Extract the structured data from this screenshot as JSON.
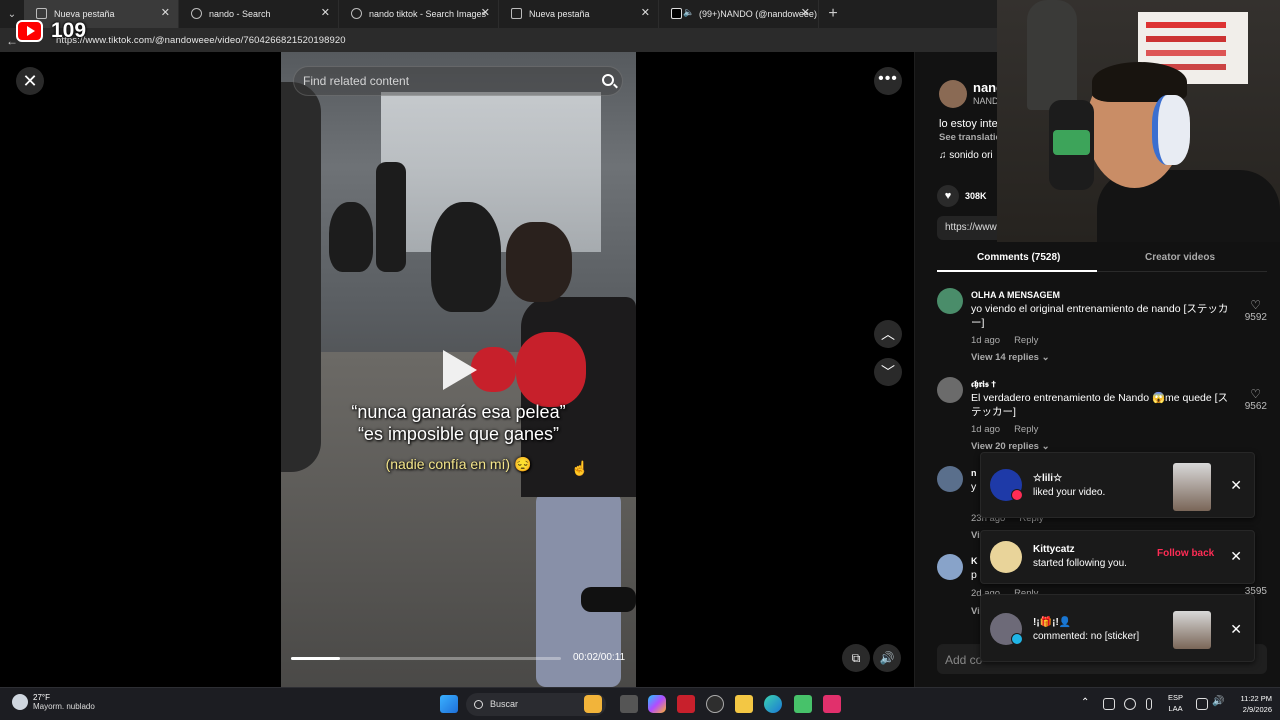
{
  "browser": {
    "tabs": [
      {
        "title": "Nueva pestaña",
        "active": true
      },
      {
        "title": "nando - Search",
        "active": false
      },
      {
        "title": "nando tiktok - Search Images",
        "active": false
      },
      {
        "title": "Nueva pestaña",
        "active": false
      },
      {
        "title": "(99+)NANDO (@nandoweee)",
        "active": false
      }
    ],
    "new_tab": "+",
    "url": "https://www.tiktok.com/@nandoweee/video/7604266821520198920"
  },
  "overlay": {
    "yt_count": "109"
  },
  "video": {
    "search_placeholder": "Find related content",
    "caption_line1": "“nunca ganarás esa pelea”",
    "caption_line2": "“es imposible que ganes”",
    "caption_line3": "(nadie confía en mí) 😔",
    "time": "00:02/00:11",
    "progress": 0.18
  },
  "author": {
    "name": "nand",
    "nickname": "NAND",
    "description": "lo estoy inte",
    "see_translation": "See translatio",
    "sound": "sonido ori",
    "likes": "308K",
    "link": "https://www"
  },
  "tabs": {
    "comments": "Comments (7528)",
    "creator_videos": "Creator videos"
  },
  "comments": [
    {
      "user": "OLHA A MENSAGEM",
      "text": "yo viendo el original entrenamiento de nando [ステッカー]",
      "time": "1d ago",
      "reply": "Reply",
      "replies": "View 14 replies ⌄",
      "likes": "9592",
      "avatar_color": "#4a8d6a"
    },
    {
      "user": "𝖈𝖍𝖗𝖎𝖘 ✝",
      "text": "El verdadero entrenamiento de Nando 😱me quede [ステッカー]",
      "time": "1d ago",
      "reply": "Reply",
      "replies": "View 20 replies ⌄",
      "likes": "9562",
      "avatar_color": "#6b6b6b"
    },
    {
      "user": "n",
      "text": "y",
      "time": "23h ago",
      "reply": "Reply",
      "replies": "Vi",
      "likes": "",
      "avatar_color": "#5a6f8c"
    },
    {
      "user": "K",
      "text": "p",
      "time": "2d ago",
      "reply": "Reply",
      "replies": "Vi",
      "likes": "3595",
      "avatar_color": "#88a3c9"
    }
  ],
  "add_comment": "Add co",
  "notifications": [
    {
      "name": "☆lili☆",
      "message": "liked your video.",
      "badge_color": "#fe2c55",
      "avatar_color": "#1e3aa8"
    },
    {
      "name": "Kittycatz",
      "message": "started following you.",
      "action": "Follow back",
      "avatar_color": "#e9d49a"
    },
    {
      "name": "!¡🎁¡!👤",
      "message": "commented: no [sticker]",
      "badge_color": "#20b5e6",
      "avatar_color": "#6d6a78"
    }
  ],
  "taskbar": {
    "weather_temp": "27°F",
    "weather_desc": "Mayorm. nublado",
    "search": "Buscar",
    "lang1": "ESP",
    "lang2": "LAA",
    "time": "11:22 PM",
    "date": "2/9/2026"
  }
}
